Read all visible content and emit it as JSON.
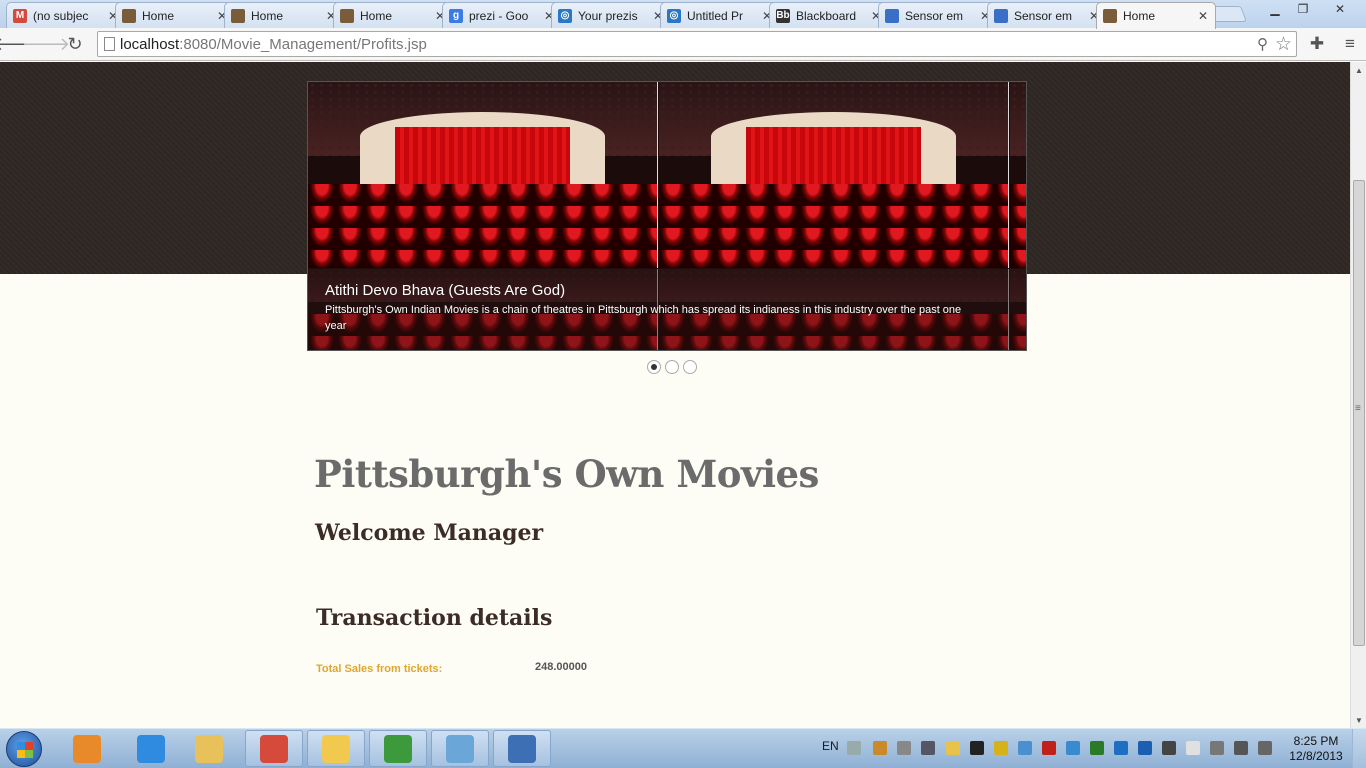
{
  "browser": {
    "tabs": [
      {
        "title": "(no subjec",
        "icon": "gmail-icon",
        "icon_color": "#d44a3c",
        "icon_char": "M"
      },
      {
        "title": "Home",
        "icon": "site-favicon",
        "icon_color": "#7a5c3a",
        "icon_char": ""
      },
      {
        "title": "Home",
        "icon": "site-favicon",
        "icon_color": "#7a5c3a",
        "icon_char": ""
      },
      {
        "title": "Home",
        "icon": "site-favicon",
        "icon_color": "#7a5c3a",
        "icon_char": ""
      },
      {
        "title": "prezi - Goo",
        "icon": "google-icon",
        "icon_color": "#3b7be8",
        "icon_char": "g"
      },
      {
        "title": "Your prezis",
        "icon": "prezi-icon",
        "icon_color": "#2a78c5",
        "icon_char": "◎"
      },
      {
        "title": "Untitled Pr",
        "icon": "prezi-icon",
        "icon_color": "#2a78c5",
        "icon_char": "◎"
      },
      {
        "title": "Blackboard",
        "icon": "blackboard-icon",
        "icon_color": "#333333",
        "icon_char": "Bb"
      },
      {
        "title": "Sensor em",
        "icon": "document-icon",
        "icon_color": "#3a6fc8",
        "icon_char": ""
      },
      {
        "title": "Sensor em",
        "icon": "document-icon",
        "icon_color": "#3a6fc8",
        "icon_char": ""
      },
      {
        "title": "Home",
        "icon": "site-favicon",
        "icon_color": "#7a5c3a",
        "icon_char": "",
        "active": true
      }
    ],
    "url_host": "localhost",
    "url_rest": ":8080/Movie_Management/Profits.jsp"
  },
  "page": {
    "slider": {
      "caption_title": "Atithi Devo Bhava (Guests Are God)",
      "caption_text": "Pittsburgh's Own Indian Movies is a chain of theatres in Pittsburgh which has spread its indianess in this industry over the past one year",
      "slide_count": 3,
      "active_slide": 1
    },
    "site_title": "Pittsburgh's Own Movies",
    "welcome": "Welcome Manager",
    "transaction_heading": "Transaction details",
    "sales_label": "Total Sales from tickets:",
    "sales_value": "248.00000"
  },
  "taskbar": {
    "apps": [
      {
        "name": "media-player-icon",
        "color": "#e8892a",
        "pinned": false
      },
      {
        "name": "internet-explorer-icon",
        "color": "#2f8be0",
        "pinned": false
      },
      {
        "name": "file-explorer-icon",
        "color": "#e9c15b",
        "pinned": false
      },
      {
        "name": "chrome-icon",
        "color": "#d64a3b",
        "pinned": true
      },
      {
        "name": "folder-window-icon",
        "color": "#f0c94e",
        "pinned": true
      },
      {
        "name": "spreadsheet-app-icon",
        "color": "#3c9a3c",
        "pinned": true
      },
      {
        "name": "notes-app-icon",
        "color": "#6aa6d8",
        "pinned": true
      },
      {
        "name": "virtualbox-icon",
        "color": "#3d6fb4",
        "pinned": true
      }
    ],
    "language": "EN",
    "time": "8:25 PM",
    "date": "12/8/2013"
  }
}
